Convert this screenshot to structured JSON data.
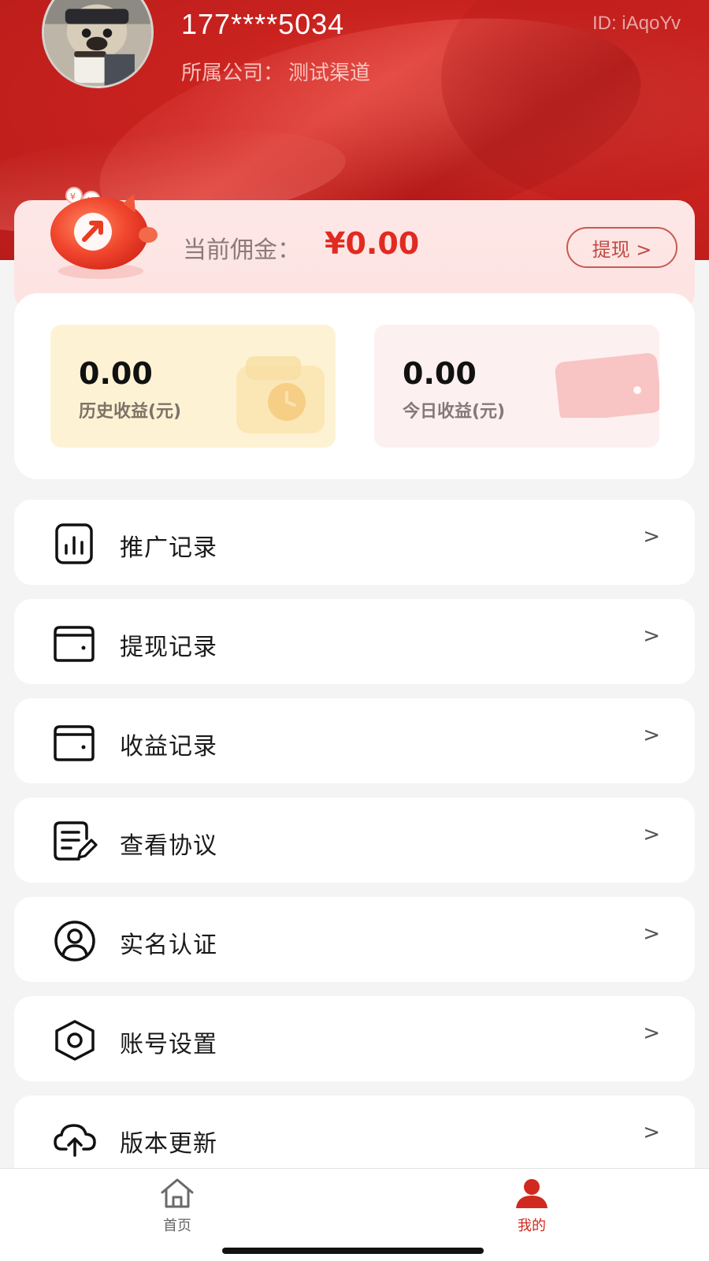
{
  "profile": {
    "phone": "177****5034",
    "user_id": "ID: iAqoYv",
    "company_label": "所属公司：",
    "company_name": "测试渠道"
  },
  "commission": {
    "label": "当前佣金：",
    "value": "¥0.00",
    "withdraw_button": "提现 >"
  },
  "earnings": [
    {
      "value": "0.00",
      "label": "历史收益(元)"
    },
    {
      "value": "0.00",
      "label": "今日收益(元)"
    }
  ],
  "menu": [
    {
      "label": "推广记录",
      "icon": "chart-document-icon",
      "arrow": ">"
    },
    {
      "label": "提现记录",
      "icon": "wallet-icon",
      "arrow": ">"
    },
    {
      "label": "收益记录",
      "icon": "wallet-icon",
      "arrow": ">"
    },
    {
      "label": "查看协议",
      "icon": "document-edit-icon",
      "arrow": ">"
    },
    {
      "label": "实名认证",
      "icon": "user-circle-icon",
      "arrow": ">"
    },
    {
      "label": "账号设置",
      "icon": "hexagon-settings-icon",
      "arrow": ">"
    },
    {
      "label": "版本更新",
      "icon": "cloud-upload-icon",
      "arrow": ">"
    }
  ],
  "tabbar": {
    "home_label": "首页",
    "mine_label": "我的",
    "active_tab": "我的"
  },
  "colors": {
    "brand_red": "#c9221f",
    "accent_red": "#e02b21",
    "history_bg": "#fdf3d4",
    "today_bg": "#fdf0f0"
  }
}
